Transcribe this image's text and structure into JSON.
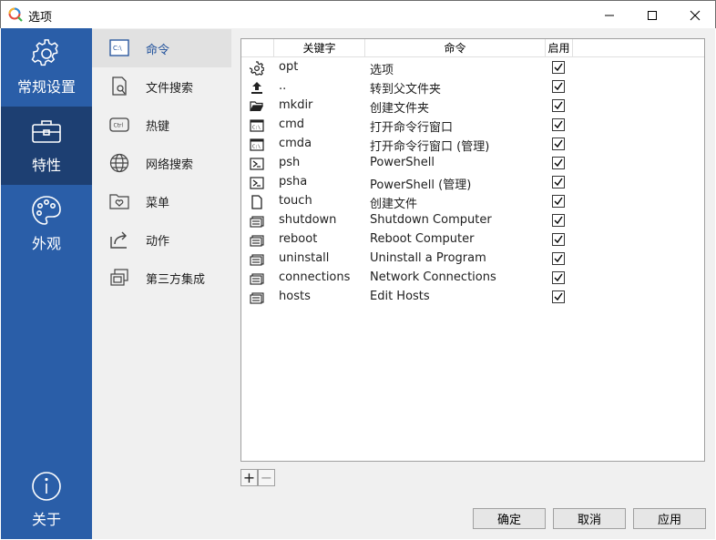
{
  "window": {
    "title": "选项"
  },
  "rail": {
    "items": [
      {
        "label": "常规设置",
        "icon": "gear-icon"
      },
      {
        "label": "特性",
        "icon": "toolbox-icon",
        "active": true
      },
      {
        "label": "外观",
        "icon": "palette-icon"
      },
      {
        "label": "关于",
        "icon": "info-icon"
      }
    ]
  },
  "subnav": {
    "items": [
      {
        "label": "命令",
        "icon": "console-icon",
        "active": true
      },
      {
        "label": "文件搜索",
        "icon": "file-search-icon"
      },
      {
        "label": "热键",
        "icon": "ctrl-key-icon"
      },
      {
        "label": "网络搜索",
        "icon": "globe-icon"
      },
      {
        "label": "菜单",
        "icon": "folder-heart-icon"
      },
      {
        "label": "动作",
        "icon": "share-arrow-icon"
      },
      {
        "label": "第三方集成",
        "icon": "windows-stack-icon"
      }
    ]
  },
  "table": {
    "headers": {
      "keyword": "关键字",
      "command": "命令",
      "enabled": "启用"
    },
    "rows": [
      {
        "keyword": "opt",
        "command": "选项",
        "icon": "gear-icon",
        "enabled": true
      },
      {
        "keyword": "..",
        "command": "转到父文件夹",
        "icon": "upload-icon",
        "enabled": true
      },
      {
        "keyword": "mkdir",
        "command": "创建文件夹",
        "icon": "folder-open-icon",
        "enabled": true
      },
      {
        "keyword": "cmd",
        "command": "打开命令行窗口",
        "icon": "cmd-window-icon",
        "enabled": true
      },
      {
        "keyword": "cmda",
        "command": "打开命令行窗口 (管理)",
        "icon": "cmd-window-icon",
        "enabled": true
      },
      {
        "keyword": "psh",
        "command": "PowerShell",
        "icon": "powershell-icon",
        "enabled": true
      },
      {
        "keyword": "psha",
        "command": "PowerShell (管理)",
        "icon": "powershell-icon",
        "enabled": true
      },
      {
        "keyword": "touch",
        "command": "创建文件",
        "icon": "file-icon",
        "enabled": true
      },
      {
        "keyword": "shutdown",
        "command": "Shutdown Computer",
        "icon": "stack-window-icon",
        "enabled": true
      },
      {
        "keyword": "reboot",
        "command": "Reboot Computer",
        "icon": "stack-window-icon",
        "enabled": true
      },
      {
        "keyword": "uninstall",
        "command": "Uninstall a Program",
        "icon": "stack-window-icon",
        "enabled": true
      },
      {
        "keyword": "connections",
        "command": "Network Connections",
        "icon": "stack-window-icon",
        "enabled": true
      },
      {
        "keyword": "hosts",
        "command": "Edit Hosts",
        "icon": "stack-window-icon",
        "enabled": true
      }
    ]
  },
  "controls": {
    "add": "+",
    "remove": "−"
  },
  "buttons": {
    "ok": "确定",
    "cancel": "取消",
    "apply": "应用"
  },
  "colors": {
    "rail_bg": "#2a5ea8",
    "rail_active": "#1d3f72",
    "accent_text": "#1e4f9a"
  }
}
